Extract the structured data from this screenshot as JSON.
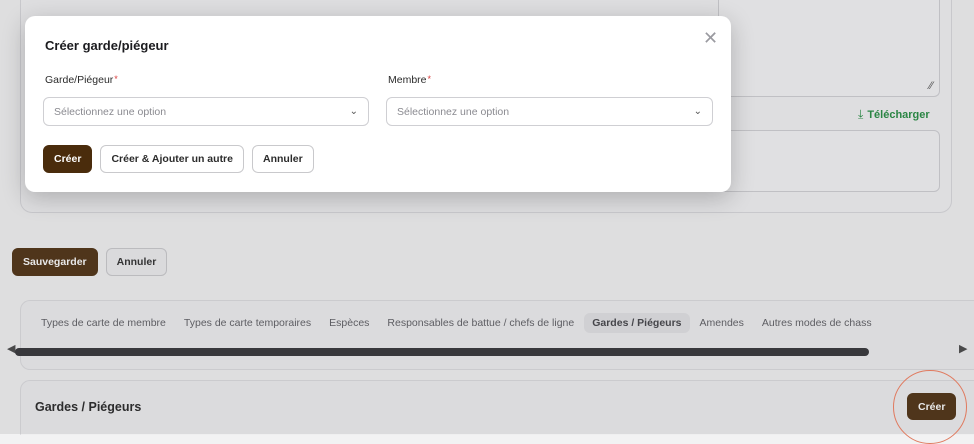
{
  "background": {
    "download_label": "Télécharger",
    "download_icon": "⤓",
    "resize_icon": "⁄⁄",
    "form_actions": {
      "save": "Sauvegarder",
      "cancel": "Annuler"
    },
    "tabs": [
      "Types de carte de membre",
      "Types de carte temporaires",
      "Espèces",
      "Responsables de battue / chefs de ligne",
      "Gardes / Piégeurs",
      "Amendes",
      "Autres modes de chass"
    ],
    "active_tab_index": 4,
    "scroll_left_icon": "◀",
    "scroll_right_icon": "▶",
    "section": {
      "title": "Gardes / Piégeurs",
      "create": "Créer"
    }
  },
  "modal": {
    "title": "Créer garde/piégeur",
    "close_icon": "✕",
    "fields": [
      {
        "label": "Garde/Piégeur",
        "required_mark": "*",
        "placeholder": "Sélectionnez une option"
      },
      {
        "label": "Membre",
        "required_mark": "*",
        "placeholder": "Sélectionnez une option"
      }
    ],
    "chevron_icon": "⌄",
    "actions": {
      "create": "Créer",
      "create_another": "Créer & Ajouter un autre",
      "cancel": "Annuler"
    }
  },
  "colors": {
    "primary": "#4a2c0c",
    "link_green": "#1f8a3c",
    "required": "#d93b3b",
    "highlight": "#e07a5f"
  }
}
